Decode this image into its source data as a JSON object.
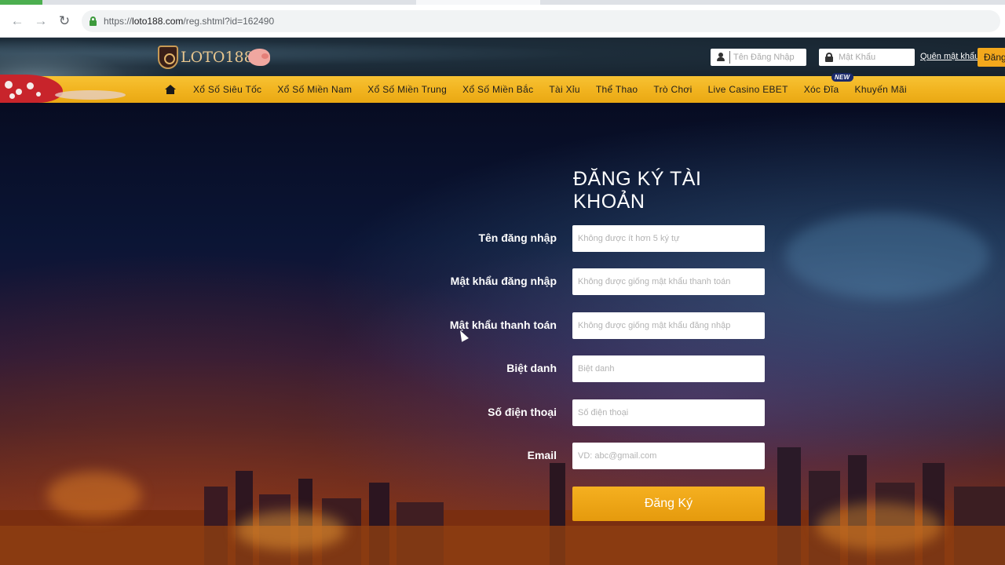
{
  "browser": {
    "url_scheme": "https://",
    "url_host": "loto188.com",
    "url_path": "/reg.shtml?id=162490",
    "back_icon": "arrow-left-icon",
    "forward_icon": "arrow-right-icon",
    "reload_icon": "reload-icon",
    "secure_icon": "lock-icon",
    "secure_color": "#3c9a3c"
  },
  "header": {
    "logo_text": "LOTO188",
    "login": {
      "username_placeholder": "Tên Đăng Nhập",
      "password_placeholder": "Mật Khẩu",
      "forgot_label": "Quên mật khẩu",
      "login_button_label": "Đăng"
    }
  },
  "nav": {
    "home_icon": "home-icon",
    "items": [
      {
        "label": "Xổ Số Siêu Tốc"
      },
      {
        "label": "Xổ Số Miền Nam"
      },
      {
        "label": "Xổ Số Miền Trung"
      },
      {
        "label": "Xổ Số Miền Bắc"
      },
      {
        "label": "Tài Xỉu"
      },
      {
        "label": "Thể Thao"
      },
      {
        "label": "Trò Chơi"
      },
      {
        "label": "Live Casino EBET"
      },
      {
        "label": "Xóc Đĩa",
        "badge": "NEW"
      },
      {
        "label": "Khuyến Mãi"
      }
    ],
    "bar_color": "#f1b31f"
  },
  "form": {
    "title": "ĐĂNG KÝ TÀI KHOẢN",
    "fields": [
      {
        "label": "Tên đăng nhập",
        "placeholder": "Không được ít hơn 5 ký tự",
        "value": ""
      },
      {
        "label": "Mật khẩu đăng nhập",
        "placeholder": "Không được giống mật khẩu thanh toán",
        "value": ""
      },
      {
        "label": "Mật khẩu thanh toán",
        "placeholder": "Không được giống mật khẩu đăng nhập",
        "value": ""
      },
      {
        "label": "Biệt danh",
        "placeholder": "Biệt danh",
        "value": ""
      },
      {
        "label": "Số điện thoại",
        "placeholder": "Số điện thoại",
        "value": ""
      },
      {
        "label": "Email",
        "placeholder": "VD: abc@gmail.com",
        "value": ""
      }
    ],
    "submit_label": "Đăng Ký",
    "submit_color": "#f0a818"
  }
}
